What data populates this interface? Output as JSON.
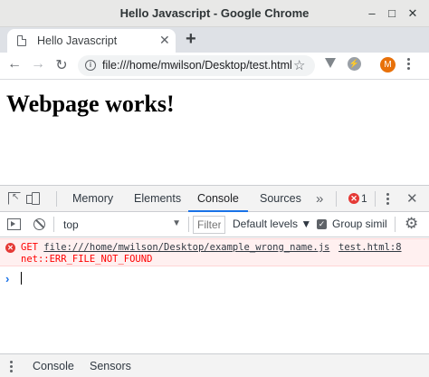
{
  "window": {
    "title": "Hello Javascript - Google Chrome"
  },
  "tab": {
    "title": "Hello Javascript"
  },
  "address_bar": {
    "url": "file:///home/mwilson/Desktop/test.html"
  },
  "profile": {
    "initial": "M"
  },
  "page": {
    "heading": "Webpage works!"
  },
  "devtools": {
    "tabs": [
      "Memory",
      "Elements",
      "Console",
      "Sources"
    ],
    "active_tab": "Console",
    "more_tabs": "»",
    "error_count": "1",
    "context": "top",
    "filter_placeholder": "Filter",
    "levels": "Default levels ▼",
    "group_similar": "Group simil",
    "console": {
      "method": "GET",
      "url": "file:///home/mwilson/Desktop/example_wrong_name.js",
      "source": "test.html:8",
      "error": "net::ERR_FILE_NOT_FOUND"
    },
    "drawer_tabs": [
      "Console",
      "Sensors"
    ]
  },
  "icons": {
    "window_controls": [
      "minimize-icon",
      "maximize-icon",
      "close-icon"
    ],
    "toolbar": [
      "back-icon",
      "forward-icon",
      "reload-icon",
      "info-icon",
      "star-icon"
    ]
  },
  "colors": {
    "accent": "#1a73e8",
    "error": "#ff0000",
    "avatar": "#e8710a"
  }
}
